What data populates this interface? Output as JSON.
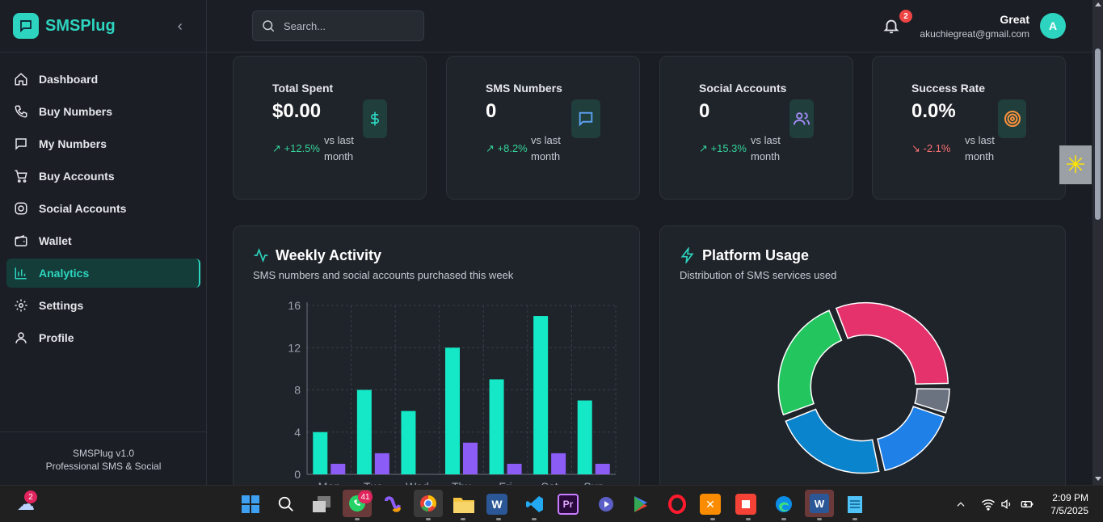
{
  "brand": {
    "name": "SMSPlug"
  },
  "sidebar": {
    "items": [
      {
        "label": "Dashboard",
        "icon": "home-icon"
      },
      {
        "label": "Buy Numbers",
        "icon": "phone-icon"
      },
      {
        "label": "My Numbers",
        "icon": "message-icon"
      },
      {
        "label": "Buy Accounts",
        "icon": "cart-icon"
      },
      {
        "label": "Social Accounts",
        "icon": "instagram-icon"
      },
      {
        "label": "Wallet",
        "icon": "wallet-icon"
      },
      {
        "label": "Analytics",
        "icon": "bar-chart-icon",
        "active": true
      },
      {
        "label": "Settings",
        "icon": "gear-icon"
      },
      {
        "label": "Profile",
        "icon": "user-icon"
      }
    ],
    "footer": {
      "version": "SMSPlug v1.0",
      "tagline": "Professional SMS & Social"
    }
  },
  "header": {
    "search_placeholder": "Search...",
    "notifications": "2",
    "user_name": "Great",
    "user_email": "akuchiegreat@gmail.com",
    "avatar_initial": "A"
  },
  "stats": [
    {
      "label": "Total Spent",
      "value": "$0.00",
      "change": "+12.5%",
      "trend": "up",
      "vs": "vs last month",
      "icon": "dollar-icon",
      "icon_color": "#2dd4bf"
    },
    {
      "label": "SMS Numbers",
      "value": "0",
      "change": "+8.2%",
      "trend": "up",
      "vs": "vs last month",
      "icon": "message-icon",
      "icon_color": "#60a5fa"
    },
    {
      "label": "Social Accounts",
      "value": "0",
      "change": "+15.3%",
      "trend": "up",
      "vs": "vs last month",
      "icon": "users-icon",
      "icon_color": "#a78bfa"
    },
    {
      "label": "Success Rate",
      "value": "0.0%",
      "change": "-2.1%",
      "trend": "down",
      "vs": "vs last month",
      "icon": "target-icon",
      "icon_color": "#fb923c"
    }
  ],
  "weekly": {
    "title": "Weekly Activity",
    "subtitle": "SMS numbers and social accounts purchased this week"
  },
  "platform": {
    "title": "Platform Usage",
    "subtitle": "Distribution of SMS services used"
  },
  "chart_data": [
    {
      "type": "bar",
      "categories": [
        "Mon",
        "Tue",
        "Wed",
        "Thu",
        "Fri",
        "Sat",
        "Sun"
      ],
      "series": [
        {
          "values": [
            4,
            8,
            6,
            12,
            9,
            15,
            7
          ],
          "color": "#14e8c6"
        },
        {
          "values": [
            1,
            2,
            0,
            3,
            1,
            2,
            1
          ],
          "color": "#8b5cf6"
        }
      ],
      "yticks": [
        "0",
        "4",
        "8",
        "12",
        "16"
      ],
      "ylim": [
        0,
        16
      ],
      "grid": true
    },
    {
      "type": "pie",
      "donut": true,
      "slices": [
        {
          "value": 30,
          "color": "#e5326d"
        },
        {
          "value": 5,
          "color": "#6b7280"
        },
        {
          "value": 16,
          "color": "#1f80e8"
        },
        {
          "value": 22,
          "color": "#0a84cc"
        },
        {
          "value": 24,
          "color": "#22c55e"
        }
      ]
    }
  ],
  "taskbar": {
    "weather_badge": "2",
    "whatsapp_badge": "41",
    "time": "2:09 PM",
    "date": "7/5/2025"
  }
}
